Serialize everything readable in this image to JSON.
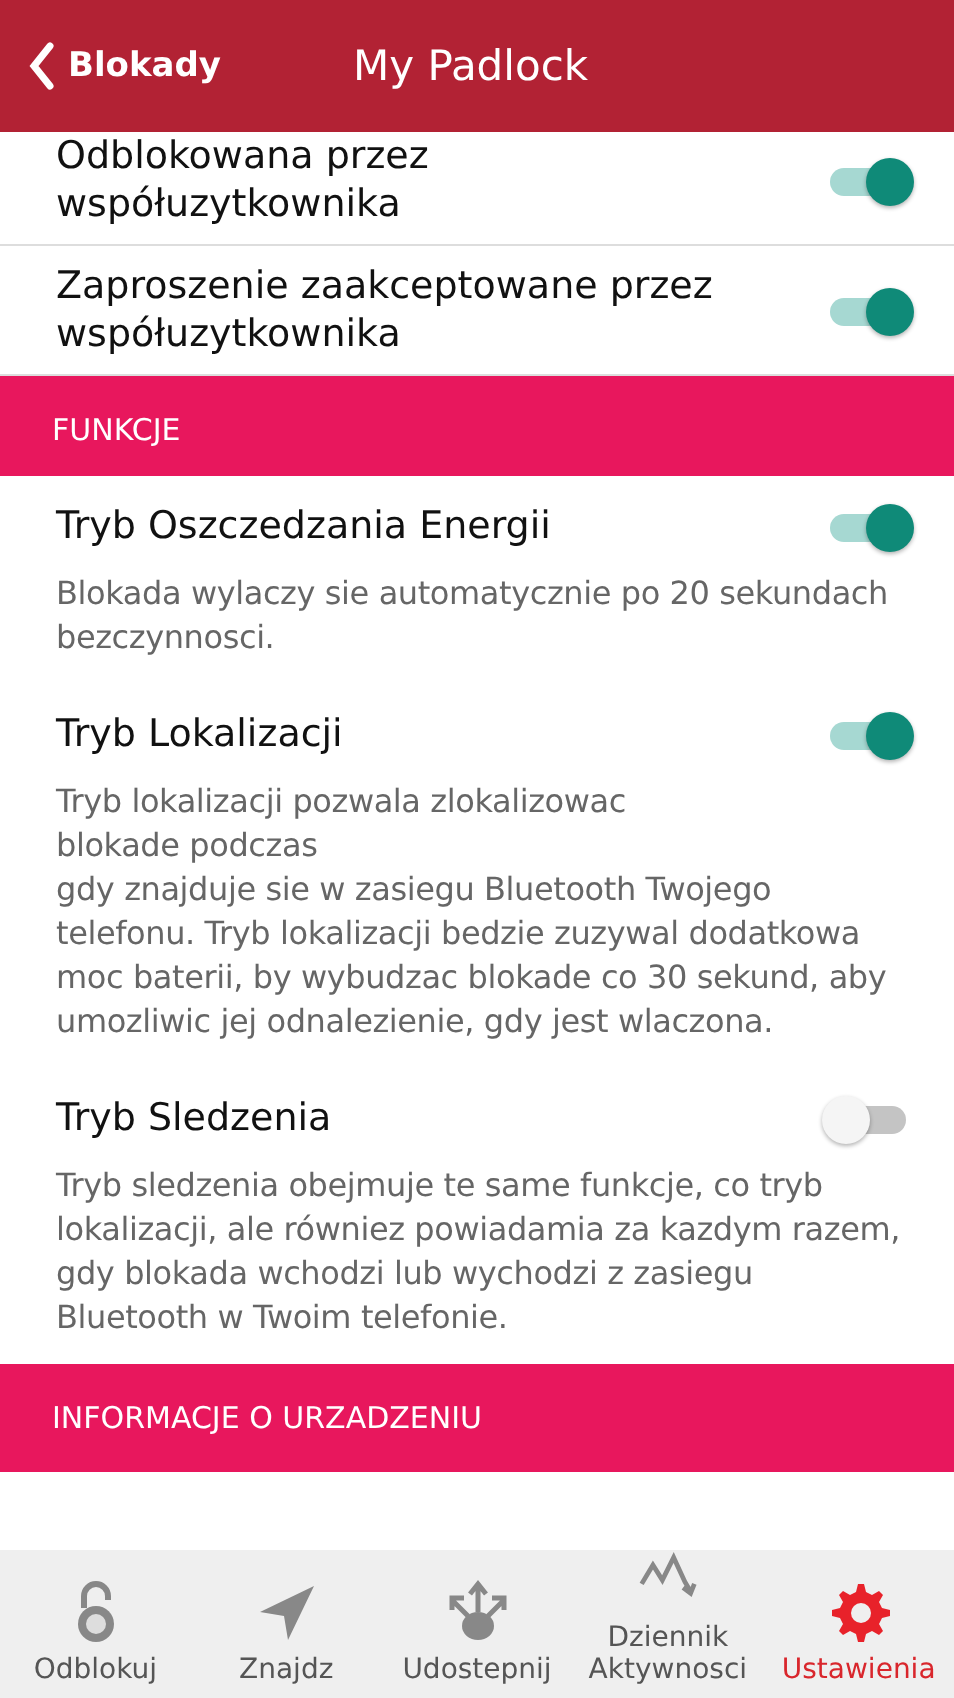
{
  "header": {
    "back_label": "Blokady",
    "title": "My Padlock"
  },
  "sections": [
    {
      "items": [
        {
          "label": "Odblokowana przez współuzytkownika",
          "on": true
        },
        {
          "label": "Zaproszenie zaakceptowane przez współuzytkownika",
          "on": true
        }
      ]
    },
    {
      "title": "FUNKCJE",
      "items": [
        {
          "label": "Tryb Oszczedzania Energii",
          "on": true,
          "description": "Blokada wylaczy sie automatycznie po 20 sekundach bezczynnosci."
        },
        {
          "label": "Tryb Lokalizacji",
          "on": true,
          "description": "Tryb lokalizacji pozwala zlokalizowac\nblokade podczas\ngdy znajduje sie w zasiegu Bluetooth Twojego telefonu. Tryb lokalizacji bedzie zuzywal dodatkowa moc baterii, by wybudzac blokade co 30 sekund, aby umozliwic jej odnalezienie, gdy jest wlaczona."
        },
        {
          "label": "Tryb Sledzenia",
          "on": false,
          "description": "Tryb sledzenia obejmuje te same funkcje, co tryb lokalizacji, ale równiez powiadamia za kazdym razem, gdy blokada wchodzi lub wychodzi z zasiegu Bluetooth w Twoim telefonie."
        }
      ]
    },
    {
      "title": "INFORMACJE O URZADZENIU"
    }
  ],
  "tabs": [
    {
      "label": "Odblokuj",
      "selected": false
    },
    {
      "label": "Znajdz",
      "selected": false
    },
    {
      "label": "Udostepnij",
      "selected": false
    },
    {
      "label": "Dziennik\nAktywnosci",
      "selected": false
    },
    {
      "label": "Ustawienia",
      "selected": true
    }
  ]
}
